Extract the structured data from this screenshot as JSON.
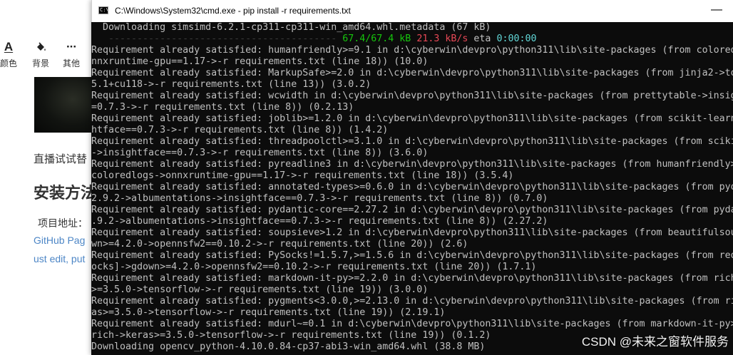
{
  "editor": {
    "toolbar": [
      {
        "icon": "font-color-icon",
        "glyph": "A",
        "label": "颜色"
      },
      {
        "icon": "paint-bucket-icon",
        "glyph": "⛾",
        "label": "背景"
      },
      {
        "icon": "more-icon",
        "glyph": "···",
        "label": "其他"
      }
    ],
    "live_text": "直播试试替",
    "heading": "安装方法",
    "project_label": "项目地址：",
    "github_link": "GitHub Pag",
    "edit_link": "ust edit, put"
  },
  "cmd": {
    "title": "C:\\Windows\\System32\\cmd.exe - pip  install -r requirements.txt",
    "icon_text": "C:\\",
    "minimize_glyph": "—",
    "progress": {
      "bar": "   ---------------------------------------- ",
      "downloaded": "67.4/67.4 kB",
      "speed": "21.3 kB/s",
      "eta_label": "eta",
      "eta": "0:00:00"
    },
    "lines_before": [
      "  Downloading simsimd-6.2.1-cp311-cp311-win_amd64.whl.metadata (67 kB)"
    ],
    "lines_after": [
      "Requirement already satisfied: humanfriendly>=9.1 in d:\\cyberwin\\devpro\\python311\\lib\\site-packages (from colored",
      "nnxruntime-gpu==1.17->-r requirements.txt (line 18)) (10.0)",
      "Requirement already satisfied: MarkupSafe>=2.0 in d:\\cyberwin\\devpro\\python311\\lib\\site-packages (from jinja2->to",
      "5.1+cu118->-r requirements.txt (line 13)) (3.0.2)",
      "Requirement already satisfied: wcwidth in d:\\cyberwin\\devpro\\python311\\lib\\site-packages (from prettytable->insig",
      "=0.7.3->-r requirements.txt (line 8)) (0.2.13)",
      "Requirement already satisfied: joblib>=1.2.0 in d:\\cyberwin\\devpro\\python311\\lib\\site-packages (from scikit-learn",
      "htface==0.7.3->-r requirements.txt (line 8)) (1.4.2)",
      "Requirement already satisfied: threadpoolctl>=3.1.0 in d:\\cyberwin\\devpro\\python311\\lib\\site-packages (from scikit",
      "->insightface==0.7.3->-r requirements.txt (line 8)) (3.6.0)",
      "Requirement already satisfied: pyreadline3 in d:\\cyberwin\\devpro\\python311\\lib\\site-packages (from humanfriendly>",
      "coloredlogs->onnxruntime-gpu==1.17->-r requirements.txt (line 18)) (3.5.4)",
      "Requirement already satisfied: annotated-types>=0.6.0 in d:\\cyberwin\\devpro\\python311\\lib\\site-packages (from pyo",
      "2.9.2->albumentations->insightface==0.7.3->-r requirements.txt (line 8)) (0.7.0)",
      "Requirement already satisfied: pydantic-core==2.27.2 in d:\\cyberwin\\devpro\\python311\\lib\\site-packages (from pyda",
      ".9.2->albumentations->insightface==0.7.3->-r requirements.txt (line 8)) (2.27.2)",
      "Requirement already satisfied: soupsieve>1.2 in d:\\cyberwin\\devpro\\python311\\lib\\site-packages (from beautifulsou",
      "wn>=4.2.0->opennsfw2==0.10.2->-r requirements.txt (line 20)) (2.6)",
      "Requirement already satisfied: PySocks!=1.5.7,>=1.5.6 in d:\\cyberwin\\devpro\\python311\\lib\\site-packages (from req",
      "ocks]->gdown>=4.2.0->opennsfw2==0.10.2->-r requirements.txt (line 20)) (1.7.1)",
      "Requirement already satisfied: markdown-it-py>=2.2.0 in d:\\cyberwin\\devpro\\python311\\lib\\site-packages (from rich",
      ">=3.5.0->tensorflow->-r requirements.txt (line 19)) (3.0.0)",
      "Requirement already satisfied: pygments<3.0.0,>=2.13.0 in d:\\cyberwin\\devpro\\python311\\lib\\site-packages (from ri",
      "as>=3.5.0->tensorflow->-r requirements.txt (line 19)) (2.19.1)",
      "Requirement already satisfied: mdurl~=0.1 in d:\\cyberwin\\devpro\\python311\\lib\\site-packages (from markdown-it-py>",
      "rich->keras>=3.5.0->tensorflow->-r requirements.txt (line 19)) (0.1.2)",
      "Downloading opencv_python-4.10.0.84-cp37-abi3-win_amd64.whl (38.8 MB)"
    ]
  },
  "watermark": "CSDN @未来之窗软件服务",
  "colors": {
    "console_bg": "#0c0c0c",
    "console_text": "#c0c0c0",
    "progress_green": "#16c60c",
    "progress_red": "#e74856",
    "progress_cyan": "#61d6d6",
    "link_blue": "#4d86c6"
  }
}
